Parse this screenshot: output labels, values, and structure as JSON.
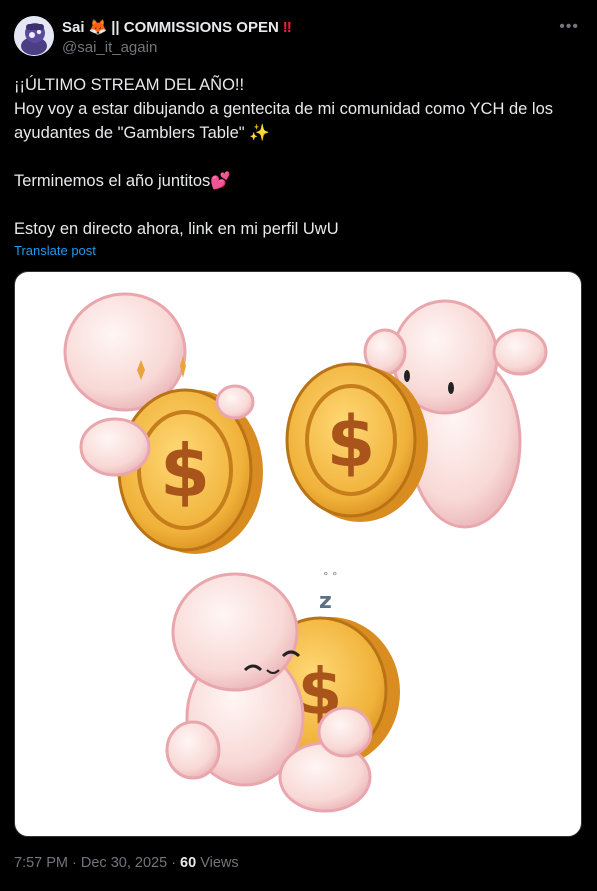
{
  "author": {
    "display_name": "Sai",
    "suffix_label": "|| COMMISSIONS OPEN",
    "handle": "@sai_it_again",
    "badge_icons": [
      "fox-face-icon",
      "double-exclamation-icon"
    ]
  },
  "post": {
    "lines": [
      "¡¡ÚLTIMO STREAM DEL AÑO!!",
      "Hoy voy a estar dibujando a gentecita de mi comunidad como YCH de los ayudantes de \"Gamblers Table\" ✨",
      "Terminemos el año juntitos💕",
      "Estoy en directo ahora, link en mi perfil UwU"
    ],
    "translate_label": "Translate post",
    "media_icon": "coin-characters-illustration"
  },
  "meta": {
    "time": "7:57 PM",
    "date": "Dec 30, 2025",
    "views_count": "60",
    "views_label": "Views"
  },
  "colors": {
    "background": "#000000",
    "text": "#e7e9ea",
    "muted": "#71767b",
    "link": "#1d9bf0"
  }
}
